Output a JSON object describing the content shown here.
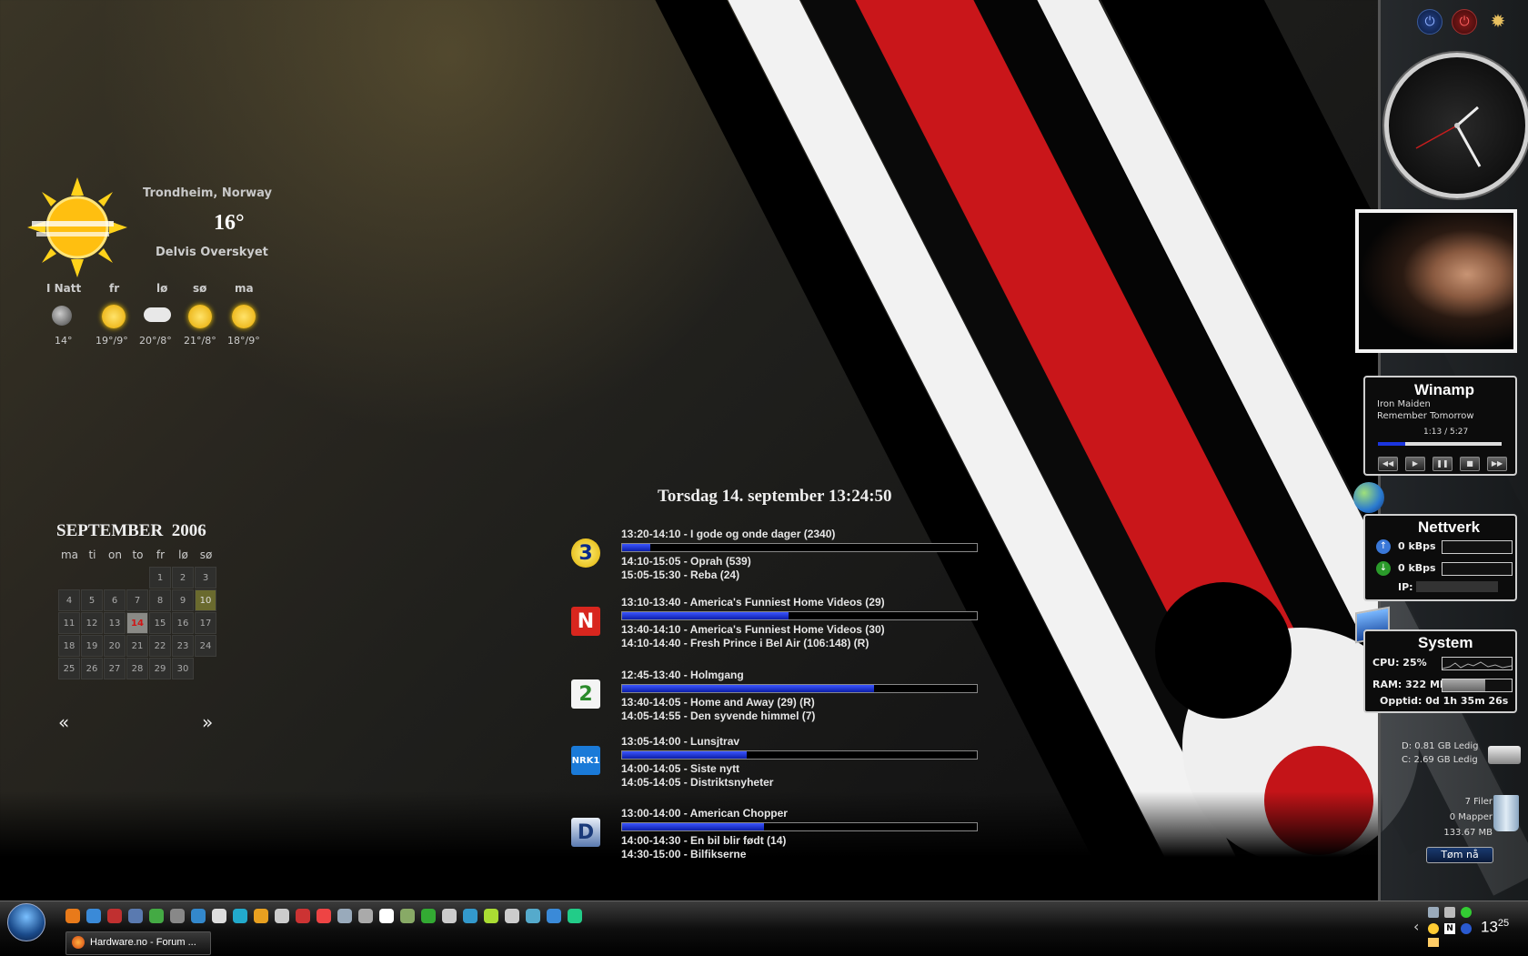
{
  "weather": {
    "location": "Trondheim, Norway",
    "temp": "16°",
    "condition": "Delvis Overskyet",
    "forecast": [
      {
        "day": "I Natt",
        "temp": "14°",
        "icon": "moon-icon"
      },
      {
        "day": "fr",
        "temp": "19°/9°",
        "icon": "sun-icon"
      },
      {
        "day": "lø",
        "temp": "20°/8°",
        "icon": "cloud-icon"
      },
      {
        "day": "sø",
        "temp": "21°/8°",
        "icon": "sun-icon"
      },
      {
        "day": "ma",
        "temp": "18°/9°",
        "icon": "partly-sunny-icon"
      }
    ]
  },
  "calendar": {
    "month": "SEPTEMBER",
    "year": "2006",
    "weekdays": [
      "ma",
      "ti",
      "on",
      "to",
      "fr",
      "lø",
      "sø"
    ],
    "weeks": [
      [
        "",
        "",
        "",
        "",
        "1",
        "2",
        "3"
      ],
      [
        "4",
        "5",
        "6",
        "7",
        "8",
        "9",
        "10"
      ],
      [
        "11",
        "12",
        "13",
        "14",
        "15",
        "16",
        "17"
      ],
      [
        "18",
        "19",
        "20",
        "21",
        "22",
        "23",
        "24"
      ],
      [
        "25",
        "26",
        "27",
        "28",
        "29",
        "30",
        ""
      ]
    ],
    "today": "14",
    "selected": "10",
    "prev_label": "«",
    "next_label": "»"
  },
  "datetime_header": "Torsdag 14. september 13:24:50",
  "tv_guide": [
    {
      "channel": "TV3",
      "logo_text": "3",
      "now": "13:20-14:10 - I gode og onde dager (2340)",
      "progress": 0.08,
      "next": [
        "14:10-15:05 - Oprah (539)",
        "15:05-15:30 - Reba (24)"
      ]
    },
    {
      "channel": "TVNorge",
      "logo_text": "N",
      "now": "13:10-13:40 - America's Funniest Home Videos (29)",
      "progress": 0.47,
      "next": [
        "13:40-14:10 - America's Funniest Home Videos (30)",
        "14:10-14:40 - Fresh Prince i Bel Air (106:148) (R)"
      ]
    },
    {
      "channel": "TV2",
      "logo_text": "2",
      "now": "12:45-13:40 - Holmgang",
      "progress": 0.71,
      "next": [
        "13:40-14:05 - Home and Away (29) (R)",
        "14:05-14:55 - Den syvende himmel (7)"
      ]
    },
    {
      "channel": "NRK1",
      "logo_text": "NRK1",
      "now": "13:05-14:00 - Lunsjtrav",
      "progress": 0.35,
      "next": [
        "14:00-14:05 - Siste nytt",
        "14:05-14:05 - Distriktsnyheter"
      ]
    },
    {
      "channel": "Discovery",
      "logo_text": "D",
      "now": "13:00-14:00 - American Chopper",
      "progress": 0.4,
      "next": [
        "14:00-14:30 - En bil blir født (14)",
        "14:30-15:00 - Bilfikserne"
      ]
    }
  ],
  "winamp": {
    "title": "Winamp",
    "artist": "Iron Maiden",
    "track": "Remember Tomorrow",
    "elapsed": "1:13",
    "separator": "/",
    "total": "5:27",
    "progress": 0.22
  },
  "network": {
    "title": "Nettverk",
    "upload": "0 kBps",
    "download": "0 kBps",
    "ip_label": "IP:"
  },
  "system": {
    "title": "System",
    "cpu": "CPU: 25%",
    "ram": "RAM: 322 MB",
    "ram_fraction": 0.62,
    "uptime": "Opptid: 0d 1h 35m 26s"
  },
  "drives": [
    "D: 0.81 GB Ledig",
    "C: 2.69 GB Ledig"
  ],
  "recycle": {
    "files": "7 Filer",
    "folders": "0 Mapper",
    "size": "133.67 MB",
    "empty_label": "Tøm nå"
  },
  "taskbar": {
    "task_label": "Hardware.no - Forum ...",
    "clock_hour": "13",
    "clock_min": "25",
    "tray_arrow": "‹"
  },
  "colors": {
    "accent_red": "#d01515",
    "progress_blue": "#1b36e0"
  }
}
